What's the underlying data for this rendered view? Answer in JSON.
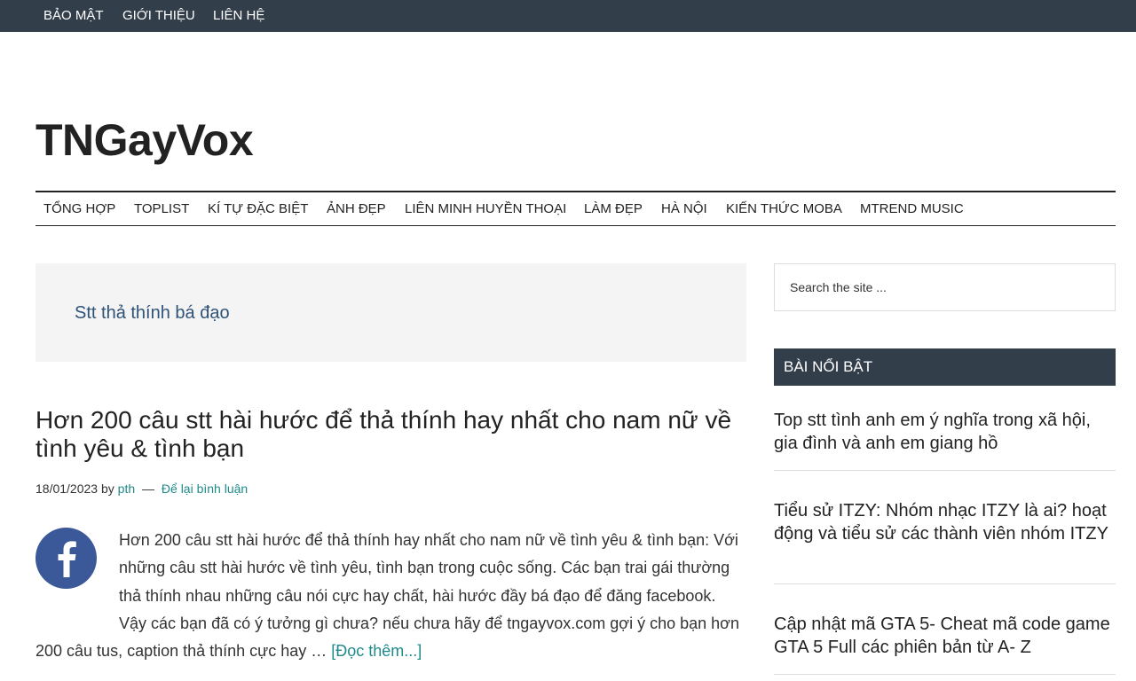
{
  "topnav": {
    "items": [
      "BẢO MẬT",
      "GIỚI THIỆU",
      "LIÊN HỆ"
    ]
  },
  "site": {
    "title": "TNGayVox"
  },
  "mainnav": {
    "items": [
      "TỔNG HỢP",
      "TOPLIST",
      "KÍ TỰ ĐẶC BIỆT",
      "ẢNH ĐẸP",
      "LIÊN MINH HUYỀN THOẠI",
      "LÀM ĐẸP",
      "HÀ NỘI",
      "KIẾN THỨC MOBA",
      "MTREND MUSIC"
    ]
  },
  "archive": {
    "title": "Stt thả thính bá đạo"
  },
  "post": {
    "title": "Hơn 200 câu stt hài hước để thả thính hay nhất cho nam nữ về tình yêu & tình bạn",
    "date": "18/01/2023",
    "by": "by",
    "author": "pth",
    "separator": "—",
    "comments": "Để lại bình luận",
    "excerpt": "Hơn 200 câu stt hài hước để thả thính hay nhất cho nam nữ về tình yêu & tình bạn: Với những câu stt hài hước về tình yêu, tình bạn trong cuộc sống. Các bạn trai gái thường thả thính nhau những câu nói cực hay chất, hài hước đầy bá đạo để đăng facebook. Vậy các bạn đã có ý tưởng gì chưa? nếu chưa hãy để tngayvox.com gợi ý cho bạn hơn 200 câu tus, caption thả thính cực hay …",
    "read_more": "[Đọc thêm...]",
    "thumbnail_icon": "facebook-icon"
  },
  "sidebar": {
    "search_placeholder": "Search the site ...",
    "featured_title": "BÀI NỔI BẬT",
    "featured_items": [
      "Top stt tình anh em ý nghĩa trong xã hội, gia đình và anh em giang hồ",
      "Tiểu sử ITZY: Nhóm nhạc ITZY là ai? hoạt động và tiểu sử các thành viên nhóm ITZY",
      "Cập nhật mã GTA 5- Cheat mã code game GTA 5 Full các phiên bản từ A- Z"
    ]
  },
  "colors": {
    "topbar": "#333e4b",
    "link": "#1e8a8a",
    "archive_title": "#2e5379",
    "facebook": "#3b5998"
  }
}
